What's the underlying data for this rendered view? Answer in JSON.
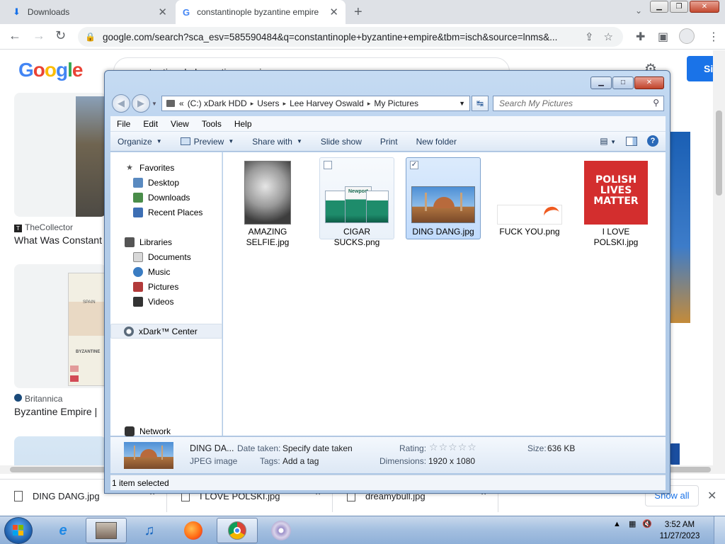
{
  "browser": {
    "tabs": [
      {
        "label": "Downloads"
      },
      {
        "label": "constantinople byzantine empire"
      }
    ],
    "url": "google.com/search?sca_esv=585590484&q=constantinople+byzantine+empire&tbm=isch&source=lnms&..."
  },
  "google": {
    "logo": "Google",
    "query": "constantinople byzantine empire",
    "signin": "Si",
    "results": [
      {
        "source": "TheCollector",
        "title": "What Was Constant"
      },
      {
        "source": "Britannica",
        "title": "Byzantine Empire |"
      }
    ],
    "map_labels": {
      "spain": "SPAIN",
      "byzantine": "BYZANTINE"
    }
  },
  "explorer": {
    "breadcrumb": [
      "«",
      "(C:) xDark HDD",
      "Users",
      "Lee Harvey Oswald",
      "My Pictures"
    ],
    "search_placeholder": "Search My Pictures",
    "menu": [
      "File",
      "Edit",
      "View",
      "Tools",
      "Help"
    ],
    "commands": {
      "organize": "Organize",
      "preview": "Preview",
      "share": "Share with",
      "slideshow": "Slide show",
      "print": "Print",
      "new_folder": "New folder"
    },
    "nav": {
      "favorites": "Favorites",
      "favorites_items": [
        "Desktop",
        "Downloads",
        "Recent Places"
      ],
      "libraries": "Libraries",
      "libraries_items": [
        "Documents",
        "Music",
        "Pictures",
        "Videos"
      ],
      "xdark": "xDark™ Center",
      "network": "Network"
    },
    "files": [
      {
        "name": "AMAZING SELFIE.jpg",
        "state": "normal"
      },
      {
        "name": "CIGAR SUCKS.png",
        "state": "hover"
      },
      {
        "name": "DING DANG.jpg",
        "state": "selected"
      },
      {
        "name": "FUCK YOU.png",
        "state": "normal"
      },
      {
        "name": "I LOVE POLSKI.jpg",
        "state": "normal"
      }
    ],
    "thumb_text": {
      "polish": "POLISH LIVES MATTER",
      "newport": "Newport"
    },
    "details": {
      "name": "DING DA...",
      "type": "JPEG image",
      "date_label": "Date taken:",
      "date_value": "Specify date taken",
      "tags_label": "Tags:",
      "tags_value": "Add a tag",
      "rating_label": "Rating:",
      "rating": 0,
      "dimensions_label": "Dimensions:",
      "dimensions_value": "1920 x 1080",
      "size_label": "Size:",
      "size_value": "636 KB"
    },
    "status": "1 item selected"
  },
  "downloads": {
    "items": [
      "DING DANG.jpg",
      "I LOVE POLSKI.jpg",
      "dreamybull.jpg"
    ],
    "show_all": "Show all"
  },
  "taskbar": {
    "time": "3:52 AM",
    "date": "11/27/2023"
  },
  "colors": {
    "google_blue": "#4285f4",
    "selection": "#c1dbfc",
    "chrome_tabstrip": "#dee1e6"
  }
}
